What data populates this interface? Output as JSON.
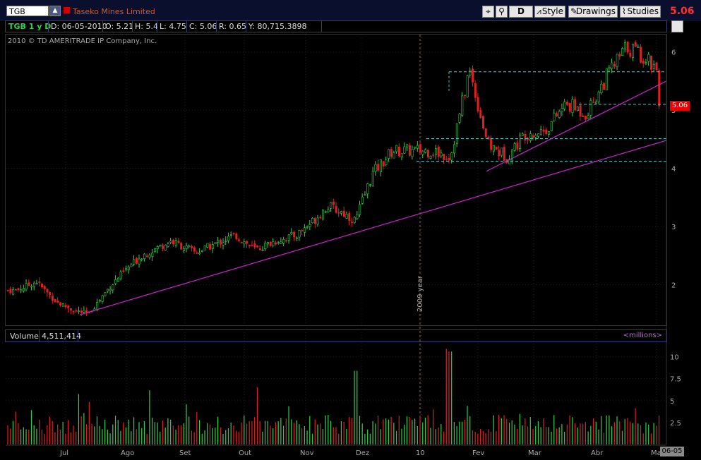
{
  "toolbar": {
    "symbol": "TGB",
    "company": "Taseko Mines Limited",
    "period_button": "D",
    "style_label": "Style",
    "drawings_label": "Drawings",
    "studies_label": "Studies",
    "last_price": "5.06"
  },
  "info": {
    "symbol_period": "TGB 1 y D",
    "date": "D: 06-05-2010",
    "open": "O: 5.21",
    "high": "H: 5.4",
    "low": "L: 4.75",
    "close": "C: 5.06",
    "range": "R: 0.65",
    "volume_info": "Y: 80,715.3898"
  },
  "copyright": "2010 © TD AMERITRADE IP Company, Inc.",
  "year_marker": "2009 year",
  "price_tag": "5.06",
  "volume_panel": {
    "label": "Volume",
    "value": "4,511,414",
    "units": "<millions>"
  },
  "date_tag": "06-05",
  "colors": {
    "up": "#2fd24a",
    "down": "#e02020",
    "trend": "#d020d0",
    "level": "#40d0d0",
    "background": "#000000"
  },
  "chart_data": {
    "type": "candlestick",
    "symbol": "TGB",
    "y_ticks": [
      "2",
      "3",
      "4",
      "5",
      "6"
    ],
    "ylim": [
      1.3,
      6.3
    ],
    "volume_ticks": [
      "2.5",
      "5",
      "7.5",
      "10"
    ],
    "volume_ylim": [
      0,
      11.5
    ],
    "months": [
      "Jul",
      "Ago",
      "Set",
      "Out",
      "Nov",
      "Dez",
      "10",
      "Fev",
      "Mar",
      "Abr",
      "Mai"
    ],
    "price_path": [
      {
        "label": "Jun",
        "value": 1.9
      },
      {
        "label": "Jun",
        "value": 2.05
      },
      {
        "label": "Jun",
        "value": 1.7
      },
      {
        "label": "Jul",
        "value": 1.55
      },
      {
        "label": "Jul",
        "value": 1.5
      },
      {
        "label": "Jul",
        "value": 1.85
      },
      {
        "label": "Jul",
        "value": 2.15
      },
      {
        "label": "Ago",
        "value": 2.5
      },
      {
        "label": "Ago",
        "value": 2.75
      },
      {
        "label": "Set",
        "value": 2.55
      },
      {
        "label": "Set",
        "value": 2.7
      },
      {
        "label": "Set",
        "value": 2.85
      },
      {
        "label": "Out",
        "value": 2.6
      },
      {
        "label": "Out",
        "value": 2.75
      },
      {
        "label": "Out",
        "value": 2.85
      },
      {
        "label": "Nov",
        "value": 3.1
      },
      {
        "label": "Nov",
        "value": 3.35
      },
      {
        "label": "Nov",
        "value": 3.25
      },
      {
        "label": "Nov",
        "value": 3.1
      },
      {
        "label": "Dez",
        "value": 3.9
      },
      {
        "label": "Dez",
        "value": 4.3
      },
      {
        "label": "Dez",
        "value": 4.3
      },
      {
        "label": "10",
        "value": 4.3
      },
      {
        "label": "10",
        "value": 4.2
      },
      {
        "label": "10",
        "value": 5.7
      },
      {
        "label": "Fev",
        "value": 4.4
      },
      {
        "label": "Fev",
        "value": 4.2
      },
      {
        "label": "Fev",
        "value": 4.6
      },
      {
        "label": "Mar",
        "value": 4.65
      },
      {
        "label": "Mar",
        "value": 5.1
      },
      {
        "label": "Mar",
        "value": 4.95
      },
      {
        "label": "Abr",
        "value": 5.6
      },
      {
        "label": "Abr",
        "value": 6.1
      },
      {
        "label": "Abr",
        "value": 5.9
      },
      {
        "label": "Mai",
        "value": 5.7
      },
      {
        "label": "Mai",
        "value": 5.06
      }
    ],
    "trendlines": [
      {
        "from": {
          "label": "Jul",
          "value": 1.48
        },
        "to": {
          "label": "Mai",
          "value": 4.48
        }
      },
      {
        "from": {
          "label": "Fev",
          "value": 3.95
        },
        "to": {
          "label": "Mai",
          "value": 5.5
        }
      }
    ],
    "levels": [
      5.66,
      5.1,
      4.51,
      4.12
    ],
    "volume_max": 10.9,
    "grid": true,
    "legend": "none"
  }
}
